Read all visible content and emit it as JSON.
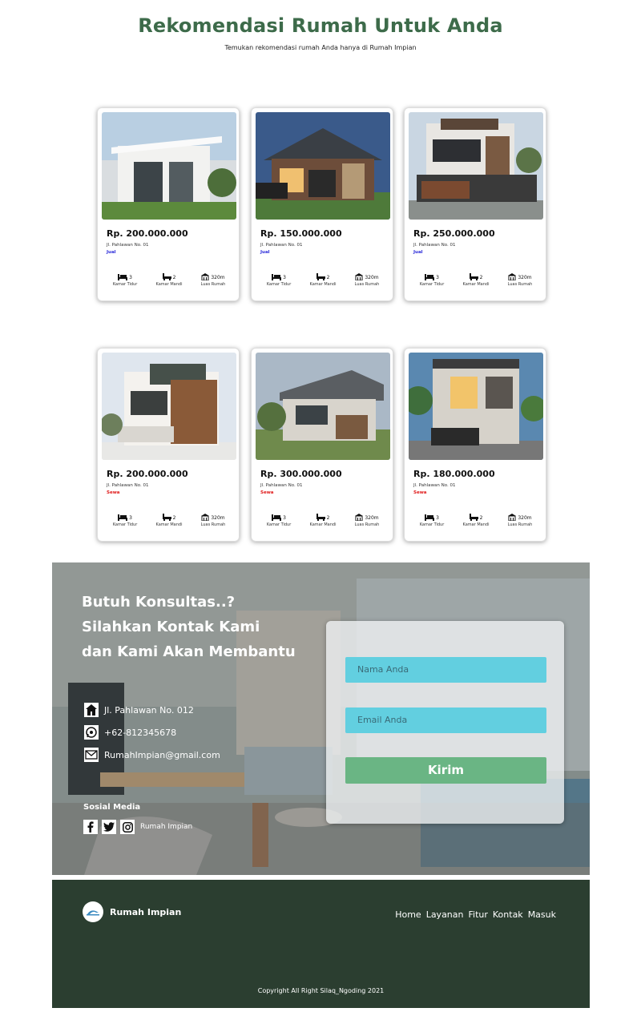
{
  "header": {
    "title": "Rekomendasi Rumah Untuk Anda",
    "subtitle": "Temukan rekomendasi rumah Anda hanya di Rumah Impian"
  },
  "listings": [
    {
      "price": "Rp. 200.000.000",
      "address": "Jl. Pahlawan No. 01",
      "status": "Jual",
      "beds": "3",
      "baths": "2",
      "area": "320m",
      "bed_label": "Kamar Tidur",
      "bath_label": "Kamar Mandi",
      "area_label": "Luas Rumah"
    },
    {
      "price": "Rp. 150.000.000",
      "address": "Jl. Pahlawan No. 01",
      "status": "Jual",
      "beds": "3",
      "baths": "2",
      "area": "320m",
      "bed_label": "Kamar Tidur",
      "bath_label": "Kamar Mandi",
      "area_label": "Luas Rumah"
    },
    {
      "price": "Rp. 250.000.000",
      "address": "Jl. Pahlawan No. 01",
      "status": "Jual",
      "beds": "3",
      "baths": "2",
      "area": "320m",
      "bed_label": "Kamar Tidur",
      "bath_label": "Kamar Mandi",
      "area_label": "Luas Rumah"
    },
    {
      "price": "Rp. 200.000.000",
      "address": "Jl. Pahlawan No. 01",
      "status": "Sewa",
      "beds": "3",
      "baths": "2",
      "area": "320m",
      "bed_label": "Kamar Tidur",
      "bath_label": "Kamar Mandi",
      "area_label": "Luas Rumah"
    },
    {
      "price": "Rp. 300.000.000",
      "address": "Jl. Pahlawan No. 01",
      "status": "Sewa",
      "beds": "3",
      "baths": "2",
      "area": "320m",
      "bed_label": "Kamar Tidur",
      "bath_label": "Kamar Mandi",
      "area_label": "Luas Rumah"
    },
    {
      "price": "Rp. 180.000.000",
      "address": "Jl. Pahlawan No. 01",
      "status": "Sewa",
      "beds": "3",
      "baths": "2",
      "area": "320m",
      "bed_label": "Kamar Tidur",
      "bath_label": "Kamar Mandi",
      "area_label": "Luas Rumah"
    }
  ],
  "contact": {
    "headline_1": "Butuh Konsultas..?",
    "headline_2": "Silahkan Kontak Kami",
    "headline_3": "dan Kami Akan Membantu",
    "address": "Jl. Pahlawan No. 012",
    "phone": "+62-812345678",
    "email": "RumahImpian@gmail.com",
    "social_title": "Sosial Media",
    "social_brand": "Rumah Impian",
    "form": {
      "name_placeholder": "Nama Anda",
      "email_placeholder": "Email Anda",
      "submit_label": "Kirim"
    }
  },
  "footer": {
    "brand": "Rumah Impian",
    "nav": [
      "Home",
      "Layanan",
      "Fitur",
      "Kontak",
      "Masuk"
    ],
    "copyright": "Copyright All Right Silaq_Ngoding 2021"
  },
  "colors": {
    "title_green": "#3d6b4a",
    "status_jual": "#2b2bd9",
    "status_sewa": "#e01b1b",
    "field_cyan": "#62cfe0",
    "button_green": "#6ab584",
    "footer_bg": "#2b3e30"
  }
}
